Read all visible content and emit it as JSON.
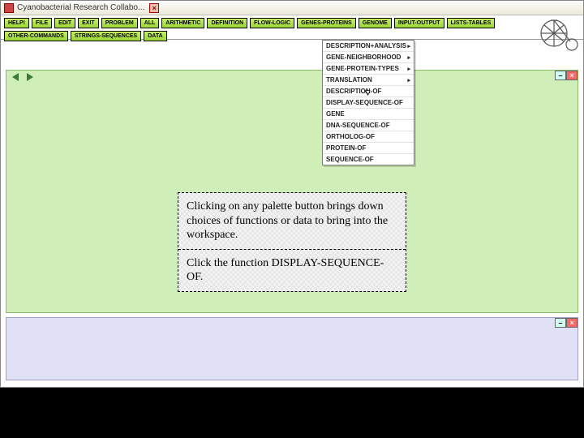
{
  "titlebar": {
    "title": "Cyanobacterial Research Collabo..."
  },
  "menu": {
    "row1": [
      "HELP!",
      "FILE",
      "EDIT",
      "EXIT",
      "PROBLEM",
      "ALL",
      "ARITHMETIC",
      "DEFINITION",
      "FLOW-LOGIC",
      "GENES-PROTEINS",
      "GENOME",
      "INPUT-OUTPUT",
      "LISTS-TABLES"
    ],
    "row2": [
      "OTHER-COMMANDS",
      "STRINGS-SEQUENCES",
      "DATA"
    ]
  },
  "dropdown": {
    "items": [
      {
        "label": "DESCRIPTION+ANALYSIS",
        "submenu": true
      },
      {
        "label": "GENE-NEIGHBORHOOD",
        "submenu": true
      },
      {
        "label": "GENE-PROTEIN-TYPES",
        "submenu": true
      },
      {
        "label": "TRANSLATION",
        "submenu": true
      },
      {
        "label": "DESCRIPTION-OF",
        "submenu": false
      },
      {
        "label": "DISPLAY-SEQUENCE-OF",
        "submenu": false
      },
      {
        "label": "GENE",
        "submenu": false
      },
      {
        "label": "DNA-SEQUENCE-OF",
        "submenu": false
      },
      {
        "label": "ORTHOLOG-OF",
        "submenu": false
      },
      {
        "label": "PROTEIN-OF",
        "submenu": false
      },
      {
        "label": "SEQUENCE-OF",
        "submenu": false
      }
    ]
  },
  "callout": {
    "p1": "Clicking on any palette button brings down choices of functions or data to bring into the workspace.",
    "p2": "Click the function DISPLAY-SEQUENCE-OF."
  },
  "icons": {
    "submenu_marker": "▸",
    "close": "×",
    "minimize": "–"
  }
}
